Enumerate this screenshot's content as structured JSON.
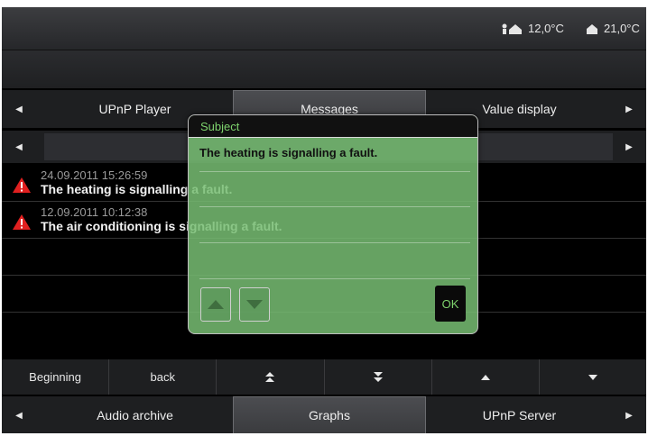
{
  "status": {
    "outdoor_icon": "outdoor-temperature-icon",
    "outdoor_temp": "12,0°C",
    "indoor_icon": "indoor-temperature-icon",
    "indoor_temp": "21,0°C"
  },
  "top_tabs": {
    "items": [
      "UPnP Player",
      "Messages",
      "Value display"
    ],
    "active": "Messages"
  },
  "filter_row": {
    "value": ""
  },
  "messages": [
    {
      "icon": "warning-icon",
      "timestamp": "24.09.2011 15:26:59",
      "text": "The heating is signalling a fault."
    },
    {
      "icon": "warning-icon",
      "timestamp": "12.09.2011 10:12:38",
      "text": "The air conditioning is signalling a fault."
    }
  ],
  "controls": {
    "beginning": "Beginning",
    "back": "back",
    "icons": [
      "double-up-icon",
      "double-down-icon",
      "up-icon",
      "down-icon"
    ]
  },
  "bottom_tabs": {
    "items": [
      "Audio archive",
      "Graphs",
      "UPnP Server"
    ],
    "active": "Graphs"
  },
  "dialog": {
    "subject_label": "Subject",
    "body": "The heating is signalling a fault.",
    "ok": "OK"
  },
  "colors": {
    "dialog_bg": "#78be73",
    "accent_green": "#7ed36d",
    "warning_red": "#e02020"
  }
}
